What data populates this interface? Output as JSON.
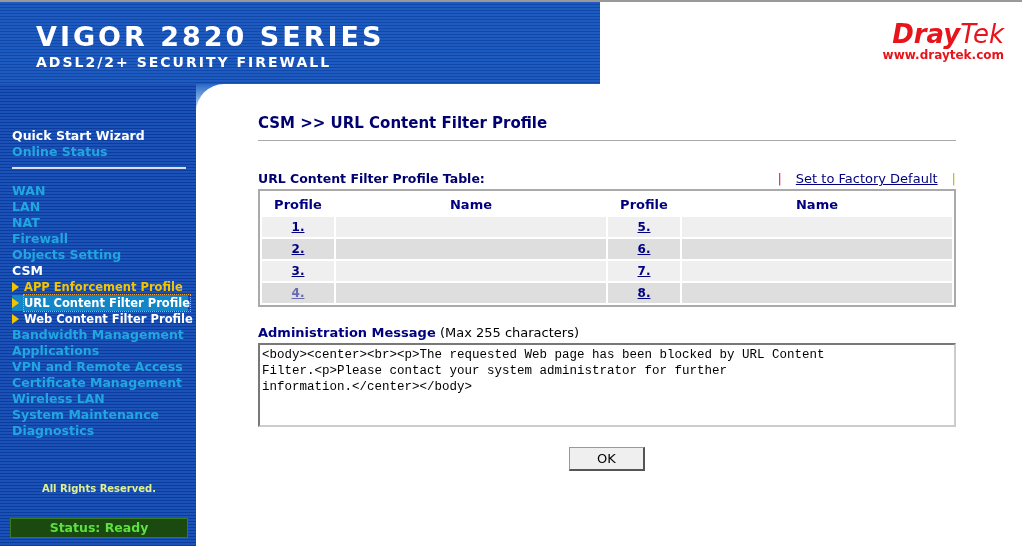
{
  "header": {
    "title": "VIGOR 2820 SERIES",
    "subtitle": "ADSL2/2+ SECURITY FIREWALL",
    "logo": {
      "brand_bold": "Dray",
      "brand_light": "Tek",
      "url": "www.draytek.com"
    }
  },
  "sidebar": {
    "items": [
      {
        "kind": "header",
        "label": "Quick Start Wizard"
      },
      {
        "kind": "link",
        "label": "Online Status"
      },
      {
        "kind": "divider"
      },
      {
        "kind": "link",
        "label": "WAN"
      },
      {
        "kind": "link",
        "label": "LAN"
      },
      {
        "kind": "link",
        "label": "NAT"
      },
      {
        "kind": "link",
        "label": "Firewall"
      },
      {
        "kind": "link",
        "label": "Objects Setting"
      },
      {
        "kind": "header",
        "label": "CSM"
      },
      {
        "kind": "sub",
        "label": "APP Enforcement Profile",
        "selected": false,
        "hovered": true
      },
      {
        "kind": "sub",
        "label": "URL Content Filter Profile",
        "selected": true,
        "hovered": false
      },
      {
        "kind": "sub",
        "label": "Web Content Filter Profile",
        "selected": false,
        "hovered": false
      },
      {
        "kind": "link",
        "label": "Bandwidth Management"
      },
      {
        "kind": "link",
        "label": "Applications"
      },
      {
        "kind": "link",
        "label": "VPN and Remote Access"
      },
      {
        "kind": "link",
        "label": "Certificate Management"
      },
      {
        "kind": "link",
        "label": "Wireless LAN"
      },
      {
        "kind": "link",
        "label": "System Maintenance"
      },
      {
        "kind": "link",
        "label": "Diagnostics"
      }
    ],
    "footer": "All Rights Reserved.",
    "status": "Status: Ready"
  },
  "page": {
    "title": "CSM >> URL Content Filter Profile",
    "table": {
      "title": "URL Content Filter Profile Table:",
      "action": "Set to Factory Default",
      "separator": "|",
      "columns": [
        "Profile",
        "Name",
        "Profile",
        "Name"
      ],
      "rows": [
        {
          "left": {
            "profile": "1.",
            "visited": false
          },
          "right": {
            "profile": "5.",
            "visited": false
          }
        },
        {
          "left": {
            "profile": "2.",
            "visited": false
          },
          "right": {
            "profile": "6.",
            "visited": false
          }
        },
        {
          "left": {
            "profile": "3.",
            "visited": false
          },
          "right": {
            "profile": "7.",
            "visited": false
          }
        },
        {
          "left": {
            "profile": "4.",
            "visited": true
          },
          "right": {
            "profile": "8.",
            "visited": false
          }
        }
      ]
    },
    "message": {
      "label": "Administration Message",
      "hint": "(Max 255 characters)",
      "value": "<body><center><br><p>The requested Web page has been blocked by URL Content\nFilter.<p>Please contact your system administrator for further\ninformation.</center></body>"
    },
    "ok_button": "OK"
  }
}
